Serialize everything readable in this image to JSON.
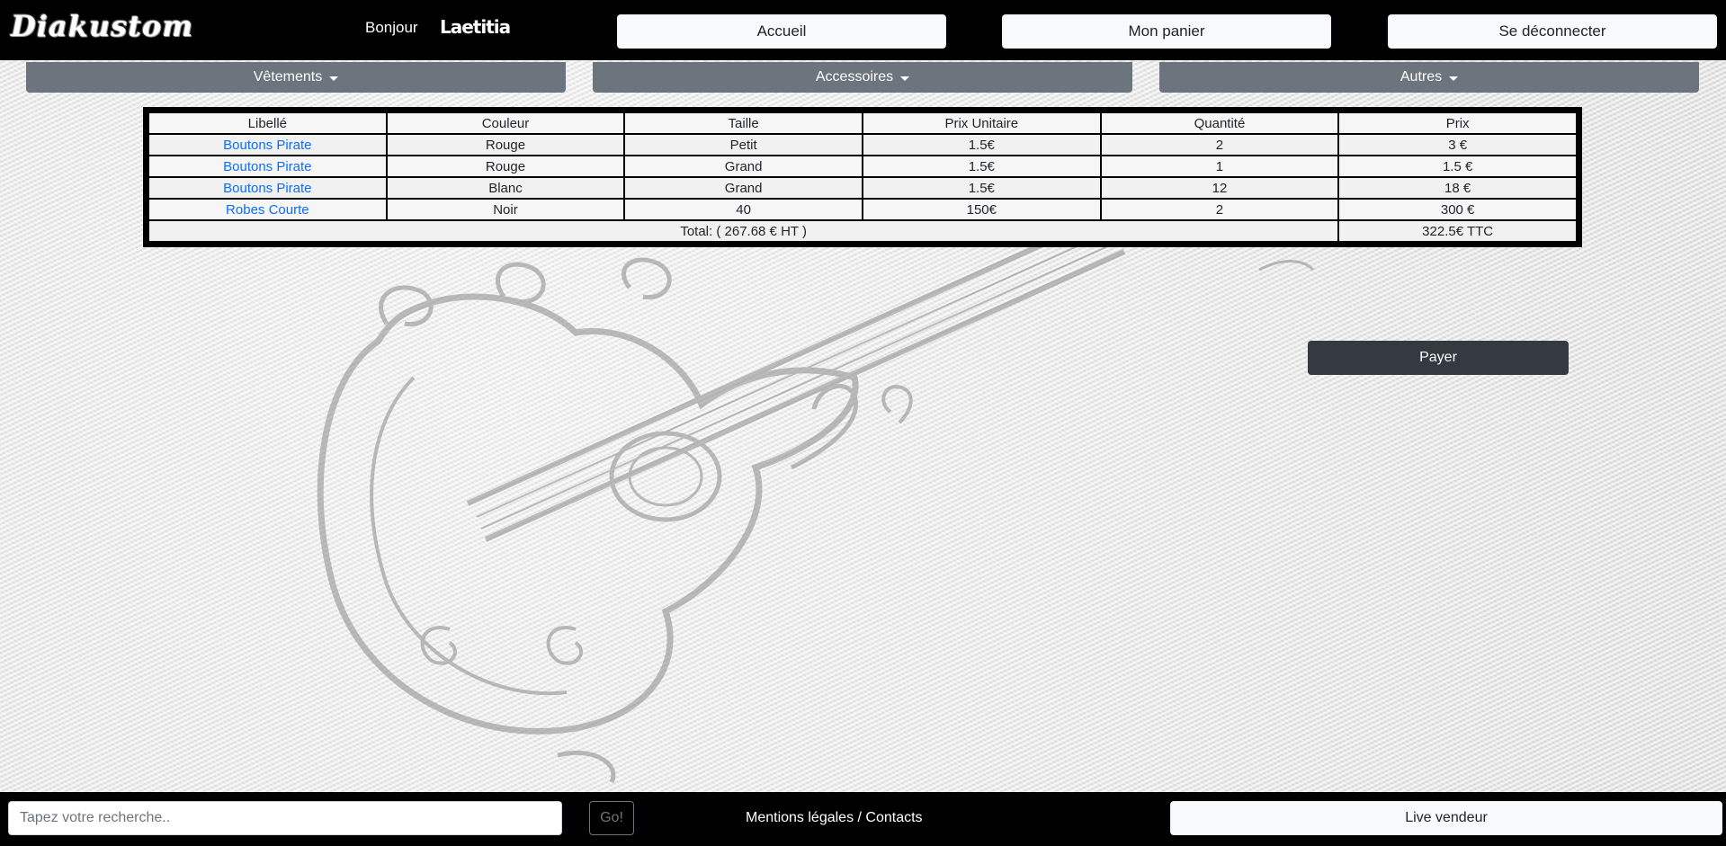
{
  "header": {
    "logo_text": "Diakustom",
    "greeting": "Bonjour",
    "username": "Laetitia",
    "nav": {
      "home": "Accueil",
      "cart": "Mon panier",
      "logout": "Se déconnecter"
    }
  },
  "categories": [
    {
      "label": "Vêtements"
    },
    {
      "label": "Accessoires"
    },
    {
      "label": "Autres"
    }
  ],
  "cart": {
    "columns": [
      "Libellé",
      "Couleur",
      "Taille",
      "Prix Unitaire",
      "Quantité",
      "Prix"
    ],
    "rows": [
      {
        "name": "Boutons Pirate",
        "color": "Rouge",
        "size": "Petit",
        "unit_price": "1.5€",
        "quantity": "2",
        "price": "3 €"
      },
      {
        "name": "Boutons Pirate",
        "color": "Rouge",
        "size": "Grand",
        "unit_price": "1.5€",
        "quantity": "1",
        "price": "1.5 €"
      },
      {
        "name": "Boutons Pirate",
        "color": "Blanc",
        "size": "Grand",
        "unit_price": "1.5€",
        "quantity": "12",
        "price": "18 €"
      },
      {
        "name": "Robes Courte",
        "color": "Noir",
        "size": "40",
        "unit_price": "150€",
        "quantity": "2",
        "price": "300 €"
      }
    ],
    "total_ht": "Total: ( 267.68 € HT )",
    "total_ttc": "322.5€ TTC",
    "pay_label": "Payer"
  },
  "footer": {
    "search_placeholder": "Tapez votre recherche..",
    "go_label": "Go!",
    "legal_link": "Mentions légales / Contacts",
    "live_seller": "Live vendeur"
  },
  "colors": {
    "navbar": "#000000",
    "category_button": "#6c757d",
    "link": "#0d6efd",
    "pay_button": "#343a40"
  }
}
